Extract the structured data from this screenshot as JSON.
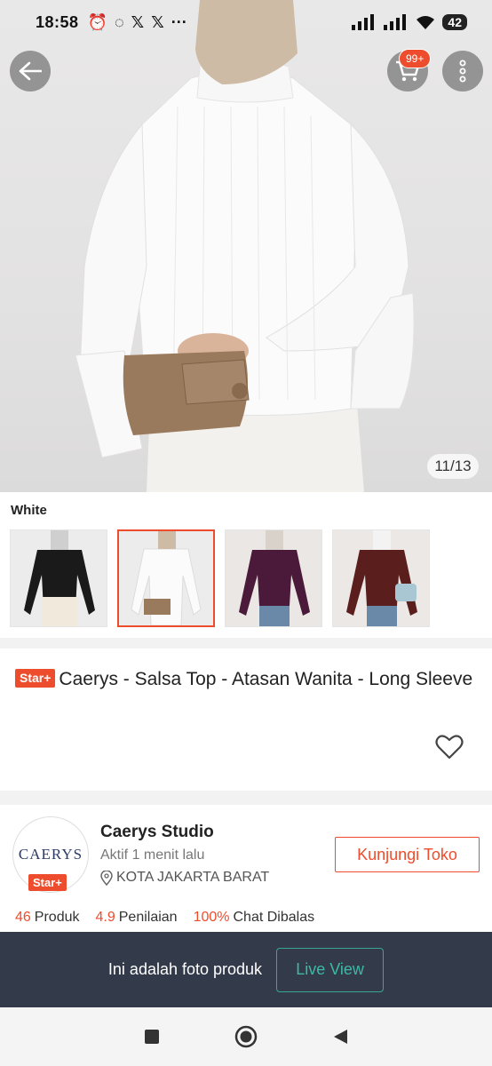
{
  "status_bar": {
    "time": "18:58",
    "battery": "42",
    "left_icons": [
      "alarm-icon",
      "whatsapp-icon",
      "x-icon",
      "x-icon",
      "more-dots-icon"
    ]
  },
  "gallery": {
    "counter": "11/13"
  },
  "cart": {
    "badge": "99+"
  },
  "variants": {
    "selected_label": "White",
    "items": [
      {
        "color": "#1a1a1a",
        "name": "black"
      },
      {
        "color": "#f6f6f6",
        "name": "white"
      },
      {
        "color": "#4b1a3a",
        "name": "plum"
      },
      {
        "color": "#5a1f1c",
        "name": "maroon"
      }
    ]
  },
  "product": {
    "badge": "Star+",
    "title": "Caerys - Salsa Top - Atasan Wanita - Long Sleeve"
  },
  "shop": {
    "avatar_text": "CAERYS",
    "badge": "Star+",
    "name": "Caerys Studio",
    "active": "Aktif 1 menit lalu",
    "location": "KOTA JAKARTA BARAT",
    "visit_label": "Kunjungi Toko",
    "stats": [
      {
        "value": "46",
        "label": "Produk"
      },
      {
        "value": "4.9",
        "label": "Penilaian"
      },
      {
        "value": "100%",
        "label": "Chat Dibalas"
      }
    ]
  },
  "banner": {
    "text": "Ini adalah foto produk",
    "button": "Live View"
  },
  "colors": {
    "accent": "#ee4d2d",
    "banner_bg": "#333a4a",
    "live_green": "#3fb8a6"
  }
}
